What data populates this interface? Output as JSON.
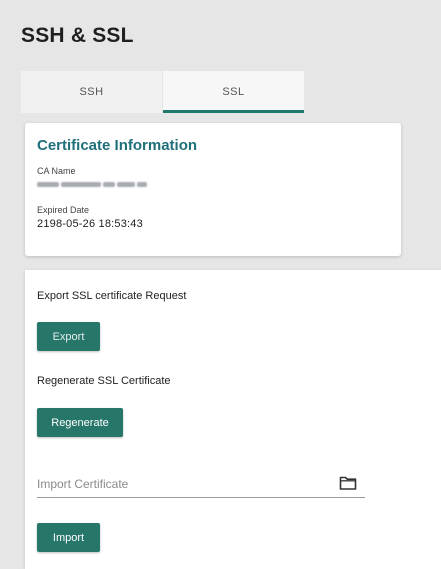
{
  "page": {
    "title": "SSH & SSL"
  },
  "tabs": [
    {
      "label": "SSH",
      "active": false
    },
    {
      "label": "SSL",
      "active": true
    }
  ],
  "certificate_info": {
    "title": "Certificate Information",
    "ca_name_label": "CA Name",
    "ca_name_value": "",
    "expired_date_label": "Expired Date",
    "expired_date_value": "2198-05-26 18:53:43"
  },
  "ssl_actions": {
    "export_label": "Export SSL certificate Request",
    "export_button": "Export",
    "regenerate_label": "Regenerate SSL Certificate",
    "regenerate_button": "Regenerate",
    "import_placeholder": "Import Certificate",
    "import_button": "Import",
    "folder_icon": "folder-icon"
  },
  "colors": {
    "accent": "#26766a",
    "title_teal": "#1f6f7a",
    "background": "#e6e6e6"
  }
}
